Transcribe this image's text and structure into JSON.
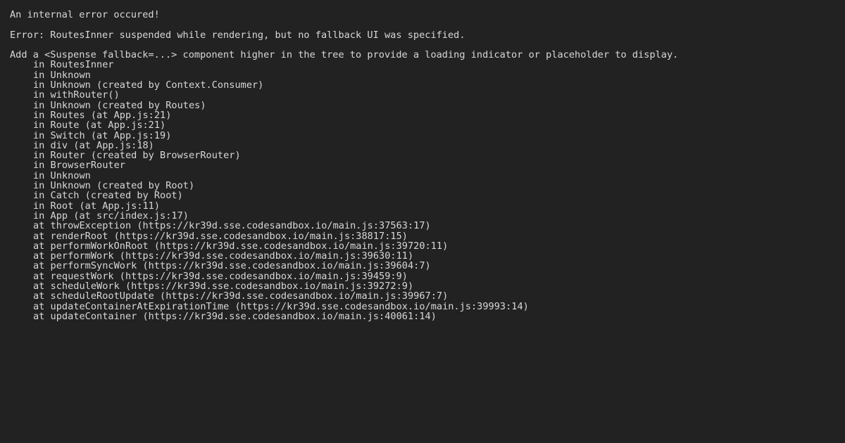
{
  "page": {
    "background_color": "#222222",
    "text_color": "#d8d8d8",
    "kind": "react-error-overlay"
  },
  "message": {
    "heading": "An internal error occured!",
    "error_line": "Error: RoutesInner suspended while rendering, but no fallback UI was specified.",
    "hint_line": "Add a <Suspense fallback=...> component higher in the tree to provide a loading indicator or placeholder to display."
  },
  "component_stack": [
    "in RoutesInner",
    "in Unknown",
    "in Unknown (created by Context.Consumer)",
    "in withRouter()",
    "in Unknown (created by Routes)",
    "in Routes (at App.js:21)",
    "in Route (at App.js:21)",
    "in Switch (at App.js:19)",
    "in div (at App.js:18)",
    "in Router (created by BrowserRouter)",
    "in BrowserRouter",
    "in Unknown",
    "in Unknown (created by Root)",
    "in Catch (created by Root)",
    "in Root (at App.js:11)",
    "in App (at src/index.js:17)"
  ],
  "js_stack": [
    "at throwException (https://kr39d.sse.codesandbox.io/main.js:37563:17)",
    "at renderRoot (https://kr39d.sse.codesandbox.io/main.js:38817:15)",
    "at performWorkOnRoot (https://kr39d.sse.codesandbox.io/main.js:39720:11)",
    "at performWork (https://kr39d.sse.codesandbox.io/main.js:39630:11)",
    "at performSyncWork (https://kr39d.sse.codesandbox.io/main.js:39604:7)",
    "at requestWork (https://kr39d.sse.codesandbox.io/main.js:39459:9)",
    "at scheduleWork (https://kr39d.sse.codesandbox.io/main.js:39272:9)",
    "at scheduleRootUpdate (https://kr39d.sse.codesandbox.io/main.js:39967:7)",
    "at updateContainerAtExpirationTime (https://kr39d.sse.codesandbox.io/main.js:39993:14)",
    "at updateContainer (https://kr39d.sse.codesandbox.io/main.js:40061:14)"
  ]
}
